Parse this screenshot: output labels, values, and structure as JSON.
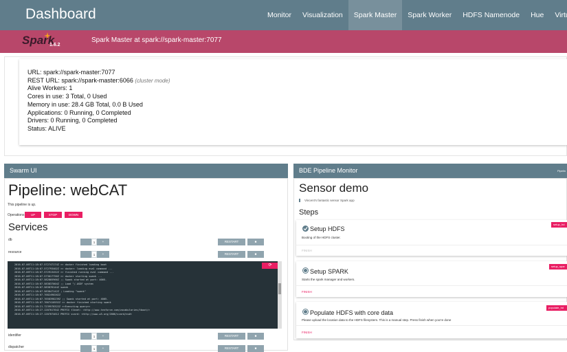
{
  "header": {
    "brand": "Dashboard",
    "nav": [
      "Monitor",
      "Visualization",
      "Spark Master",
      "Spark Worker",
      "HDFS Namenode",
      "Hue",
      "Virtuoso"
    ]
  },
  "spark": {
    "logo": "Spark",
    "version": "1.6.2",
    "title": "Spark Master at spark://spark-master:7077",
    "url": "URL: spark://spark-master:7077",
    "rest_url": "REST URL: spark://spark-master:6066",
    "rest_mode": "(cluster mode)",
    "workers": "Alive Workers: 1",
    "cores": "Cores in use: 3 Total, 0 Used",
    "memory": "Memory in use: 28.4 GB Total, 0.0 B Used",
    "applications": "Applications: 0 Running, 0 Completed",
    "drivers": "Drivers: 0 Running, 0 Completed",
    "status": "Status: ALIVE"
  },
  "swarm": {
    "panel_title": "Swarm UI",
    "pipeline_title": "Pipeline: webCAT",
    "status_text": "This pipeline is up.",
    "operations_label": "Operations",
    "ops": [
      "UP",
      "STOP",
      "DOWN"
    ],
    "services_title": "Services",
    "services": [
      {
        "name": "db",
        "count": "1",
        "plus": "+",
        "restart": "RESTART"
      },
      {
        "name": "resource",
        "count": "1",
        "plus": "+",
        "restart": "RESTART"
      },
      {
        "name": "identifier",
        "count": "1",
        "plus": "+",
        "restart": "RESTART"
      },
      {
        "name": "dispatcher",
        "count": "1",
        "plus": "+",
        "restart": "RESTART"
      }
    ],
    "logs": [
      "2016-07-06T11:18:07.572747174Z >> docker finished loading boot",
      "2016-07-06T11:18:07.572793402Z >> docker: loading eval command ...",
      "2016-07-06T11:18:07.572913452Z >> finished running eval command ...",
      "2016-07-06T11:18:07.573017756Z >> docker starting swank ...",
      "2016-07-06T11:18:07.582805966Z ;; Swank started at port: 4005.",
      "2016-07-06T11:18:07.583837004Z ;; Load \"/.ASDF system",
      "2016-07-06T11:18:07.583876144Z swank",
      "2016-07-06T11:18:07.583847142Z ; Loading \"swank\"",
      "2016-07-06T11:18:07.7682490262Z",
      "2016-07-06T11:18:07.7658398239Z ;; Swank started at port: 4005.",
      "2016-07-06T11:18:07.7667410552Z >> docker finished starting swank",
      "2016-07-06T11:18:21.7239578322Z >>Executing query>>",
      "2016-07-06T11:18:27.1207017642 PREFIX tlbnet: <http://www.tenforce.com/vocabularies/tboot/>",
      "2016-07-06T11:18:27.1207074612 PREFIX vcard: <http://www.w3.org/2006/vcard/ns#>"
    ],
    "close_glyph": "⟳"
  },
  "bde": {
    "panel_title": "BDE Pipeline Monitor",
    "panel_link": "Pipelin",
    "sensor_title": "Sensor demo",
    "sensor_sub": "Vincent's fantastic sensor Spark app",
    "steps_title": "Steps",
    "steps": [
      {
        "title": "Setup HDFS",
        "desc": "Booting of the HDFS cluster.",
        "finish": "FINISH",
        "tag": "setup_hd"
      },
      {
        "title": "Setup SPARK",
        "desc": "Starts the spark manager and workers.",
        "finish": "FINISH",
        "tag": "setup_spar"
      },
      {
        "title": "Populate HDFS with core data",
        "desc": "Please upload the location data to the HDFS filesystem. This is a manual step. Press finish when you're done",
        "finish": "FINISH",
        "tag": "populate_hd"
      }
    ]
  },
  "colors": {
    "header": "#607d8b",
    "spark_bar": "#b8476a",
    "accent": "#e91e63"
  }
}
